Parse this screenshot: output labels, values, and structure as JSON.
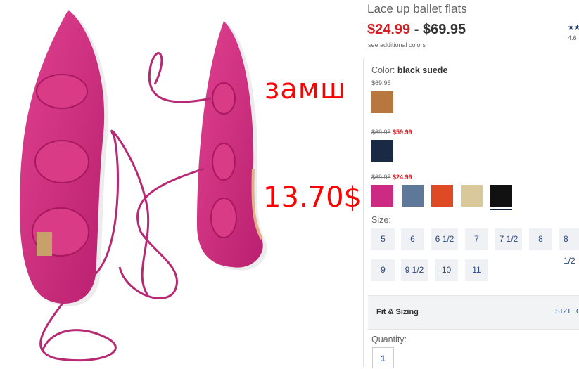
{
  "product": {
    "title": "Lace up ballet flats",
    "price_low": "$24.99",
    "price_sep": "-",
    "price_high": "$69.95",
    "see_colors": "see additional colors",
    "rating_stars": "★★",
    "rating_value": "4.6"
  },
  "annotations": {
    "material": "замш",
    "price": "13.70$"
  },
  "color": {
    "label": "Color:",
    "selected": "black suede",
    "groups": [
      {
        "price": "$69.95"
      },
      {
        "old_price": "$69.95",
        "new_price": "$59.99"
      },
      {
        "old_price": "$69.95",
        "new_price": "$24.99"
      }
    ],
    "swatches": [
      "#b7773f",
      "#1a2a45",
      "#cc2a83",
      "#5d7898",
      "#de4a24",
      "#d8c89a",
      "#111111"
    ]
  },
  "size": {
    "label": "Size:",
    "options": [
      "5",
      "6",
      "6 1/2",
      "7",
      "7 1/2",
      "8",
      "8 1/2",
      "9",
      "9 1/2",
      "10",
      "11"
    ]
  },
  "fit": {
    "label": "Fit & Sizing",
    "guide": "SIZE G"
  },
  "quantity": {
    "label": "Quantity:",
    "value": "1"
  }
}
